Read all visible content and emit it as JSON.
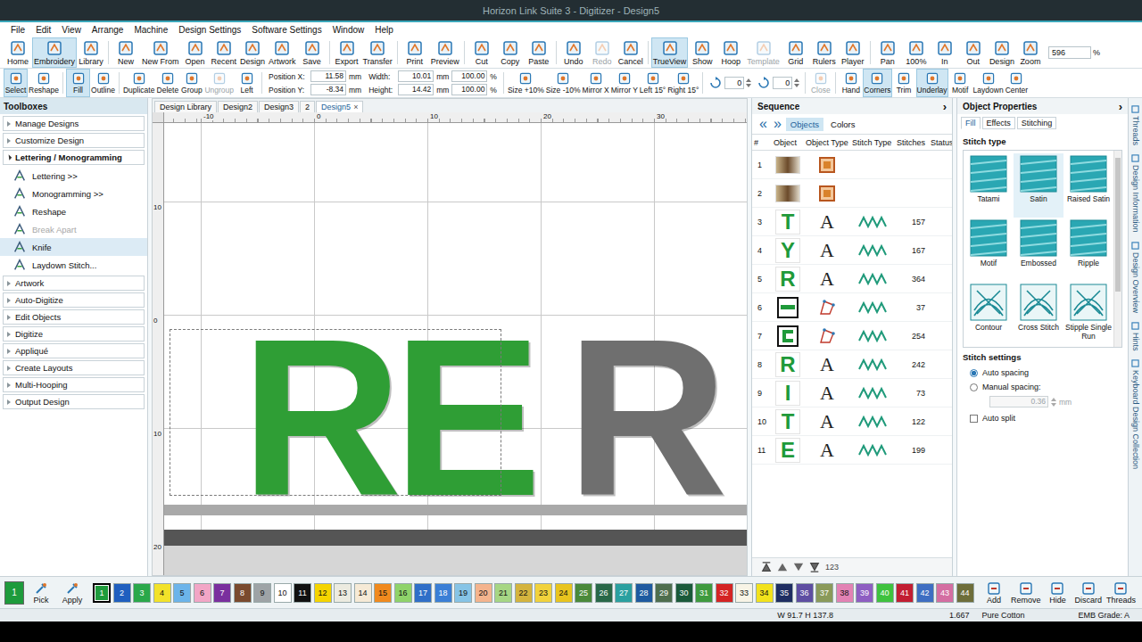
{
  "window": {
    "title": "Horizon Link Suite 3 - Digitizer - Design5"
  },
  "menu": [
    "File",
    "Edit",
    "View",
    "Arrange",
    "Machine",
    "Design Settings",
    "Software Settings",
    "Window",
    "Help"
  ],
  "toolbar": [
    {
      "kind": "button",
      "label": "Home",
      "selected": false,
      "disabled": false
    },
    {
      "kind": "button",
      "label": "Embroidery",
      "selected": true,
      "disabled": false
    },
    {
      "kind": "button",
      "label": "Library",
      "selected": false,
      "disabled": false
    },
    {
      "kind": "separator"
    },
    {
      "kind": "button",
      "label": "New",
      "selected": false,
      "disabled": false
    },
    {
      "kind": "button",
      "label": "New From",
      "selected": false,
      "disabled": false
    },
    {
      "kind": "button",
      "label": "Open",
      "selected": false,
      "disabled": false
    },
    {
      "kind": "button",
      "label": "Recent",
      "selected": false,
      "disabled": false
    },
    {
      "kind": "button",
      "label": "Design",
      "selected": false,
      "disabled": false
    },
    {
      "kind": "button",
      "label": "Artwork",
      "selected": false,
      "disabled": false
    },
    {
      "kind": "button",
      "label": "Save",
      "selected": false,
      "disabled": false
    },
    {
      "kind": "separator"
    },
    {
      "kind": "button",
      "label": "Export",
      "selected": false,
      "disabled": false
    },
    {
      "kind": "button",
      "label": "Transfer",
      "selected": false,
      "disabled": false
    },
    {
      "kind": "separator"
    },
    {
      "kind": "button",
      "label": "Print",
      "selected": false,
      "disabled": false
    },
    {
      "kind": "button",
      "label": "Preview",
      "selected": false,
      "disabled": false
    },
    {
      "kind": "separator"
    },
    {
      "kind": "button",
      "label": "Cut",
      "selected": false,
      "disabled": false
    },
    {
      "kind": "button",
      "label": "Copy",
      "selected": false,
      "disabled": false
    },
    {
      "kind": "button",
      "label": "Paste",
      "selected": false,
      "disabled": false
    },
    {
      "kind": "separator"
    },
    {
      "kind": "button",
      "label": "Undo",
      "selected": false,
      "disabled": false
    },
    {
      "kind": "button",
      "label": "Redo",
      "selected": false,
      "disabled": true
    },
    {
      "kind": "button",
      "label": "Cancel",
      "selected": false,
      "disabled": false
    },
    {
      "kind": "separator"
    },
    {
      "kind": "button",
      "label": "TrueView",
      "selected": true,
      "disabled": false
    },
    {
      "kind": "button",
      "label": "Show",
      "selected": false,
      "disabled": false
    },
    {
      "kind": "button",
      "label": "Hoop",
      "selected": false,
      "disabled": false
    },
    {
      "kind": "button",
      "label": "Template",
      "selected": false,
      "disabled": true
    },
    {
      "kind": "button",
      "label": "Grid",
      "selected": false,
      "disabled": false
    },
    {
      "kind": "button",
      "label": "Rulers",
      "selected": false,
      "disabled": false
    },
    {
      "kind": "button",
      "label": "Player",
      "selected": false,
      "disabled": false
    },
    {
      "kind": "separator"
    },
    {
      "kind": "button",
      "label": "Pan",
      "selected": false,
      "disabled": false
    },
    {
      "kind": "button",
      "label": "100%",
      "selected": false,
      "disabled": false
    },
    {
      "kind": "button",
      "label": "In",
      "selected": false,
      "disabled": false
    },
    {
      "kind": "button",
      "label": "Out",
      "selected": false,
      "disabled": false
    },
    {
      "kind": "button",
      "label": "Design",
      "selected": false,
      "disabled": false
    },
    {
      "kind": "button",
      "label": "Zoom",
      "selected": false,
      "disabled": false
    },
    {
      "kind": "field",
      "value": "596",
      "unit": "%"
    }
  ],
  "toolbar2": [
    {
      "kind": "button",
      "label": "Select",
      "selected": true,
      "disabled": false
    },
    {
      "kind": "button",
      "label": "Reshape",
      "selected": false,
      "disabled": false
    },
    {
      "kind": "separator"
    },
    {
      "kind": "button",
      "label": "Fill",
      "selected": true,
      "disabled": false
    },
    {
      "kind": "button",
      "label": "Outline",
      "selected": false,
      "disabled": false
    },
    {
      "kind": "separator"
    },
    {
      "kind": "button",
      "label": "Duplicate",
      "selected": false,
      "disabled": false
    },
    {
      "kind": "button",
      "label": "Delete",
      "selected": false,
      "disabled": false
    },
    {
      "kind": "button",
      "label": "Group",
      "selected": false,
      "disabled": false
    },
    {
      "kind": "button",
      "label": "Ungroup",
      "selected": false,
      "disabled": true
    },
    {
      "kind": "button",
      "label": "Left",
      "selected": false,
      "disabled": false
    },
    {
      "kind": "separator"
    },
    {
      "kind": "fields",
      "rows": [
        {
          "label": "Position X:",
          "value": "11.58",
          "unit": "mm"
        },
        {
          "label": "Position Y:",
          "value": "-8.34",
          "unit": "mm"
        }
      ]
    },
    {
      "kind": "fields",
      "rows": [
        {
          "label": "Width:",
          "value": "10.01",
          "unit": "mm",
          "pct": "100.00",
          "pct_unit": "%"
        },
        {
          "label": "Height:",
          "value": "14.42",
          "unit": "mm",
          "pct": "100.00",
          "pct_unit": "%"
        }
      ]
    },
    {
      "kind": "separator"
    },
    {
      "kind": "button",
      "label": "Size +10%",
      "selected": false,
      "disabled": false
    },
    {
      "kind": "button",
      "label": "Size -10%",
      "selected": false,
      "disabled": false
    },
    {
      "kind": "button",
      "label": "Mirror X",
      "selected": false,
      "disabled": false
    },
    {
      "kind": "button",
      "label": "Mirror Y",
      "selected": false,
      "disabled": false
    },
    {
      "kind": "button",
      "label": "Left 15°",
      "selected": false,
      "disabled": false
    },
    {
      "kind": "button",
      "label": "Right 15°",
      "selected": false,
      "disabled": false
    },
    {
      "kind": "separator"
    },
    {
      "kind": "spin",
      "value": "0"
    },
    {
      "kind": "spin",
      "value": "0"
    },
    {
      "kind": "separator"
    },
    {
      "kind": "button",
      "label": "Close",
      "selected": false,
      "disabled": true
    },
    {
      "kind": "separator"
    },
    {
      "kind": "button",
      "label": "Hand",
      "selected": false,
      "disabled": false
    },
    {
      "kind": "button",
      "label": "Corners",
      "selected": true,
      "disabled": false
    },
    {
      "kind": "button",
      "label": "Trim",
      "selected": false,
      "disabled": false
    },
    {
      "kind": "button",
      "label": "Underlay",
      "selected": true,
      "disabled": false
    },
    {
      "kind": "button",
      "label": "Motif",
      "selected": false,
      "disabled": false
    },
    {
      "kind": "button",
      "label": "Laydown",
      "selected": false,
      "disabled": false
    },
    {
      "kind": "button",
      "label": "Center",
      "selected": false,
      "disabled": false
    }
  ],
  "toolboxes": {
    "title": "Toolboxes",
    "sections": [
      {
        "label": "Manage Designs",
        "expanded": false,
        "items": []
      },
      {
        "label": "Customize Design",
        "expanded": false,
        "items": []
      },
      {
        "label": "Lettering / Monogramming",
        "expanded": true,
        "items": [
          {
            "label": "Lettering >>",
            "disabled": false,
            "hovered": false
          },
          {
            "label": "Monogramming >>",
            "disabled": false,
            "hovered": false
          },
          {
            "label": "Reshape",
            "disabled": false,
            "hovered": false
          },
          {
            "label": "Break Apart",
            "disabled": true,
            "hovered": false
          },
          {
            "label": "Knife",
            "disabled": false,
            "hovered": true
          },
          {
            "label": "Laydown Stitch...",
            "disabled": false,
            "hovered": false
          }
        ]
      },
      {
        "label": "Artwork",
        "expanded": false,
        "items": []
      },
      {
        "label": "Auto-Digitize",
        "expanded": false,
        "items": []
      },
      {
        "label": "Edit Objects",
        "expanded": false,
        "items": []
      },
      {
        "label": "Digitize",
        "expanded": false,
        "items": []
      },
      {
        "label": "Appliqué",
        "expanded": false,
        "items": []
      },
      {
        "label": "Create Layouts",
        "expanded": false,
        "items": []
      },
      {
        "label": "Multi-Hooping",
        "expanded": false,
        "items": []
      },
      {
        "label": "Output Design",
        "expanded": false,
        "items": []
      }
    ]
  },
  "doc_tabs": [
    {
      "label": "Design Library",
      "selected": false
    },
    {
      "label": "Design2",
      "selected": false
    },
    {
      "label": "Design3",
      "selected": false
    },
    {
      "label": "2",
      "selected": false
    },
    {
      "label": "Design5",
      "selected": true,
      "close": "×"
    }
  ],
  "canvas": {
    "ruler_top": [
      "-10",
      "0",
      "10",
      "20",
      "30"
    ],
    "ruler_left": [
      "10",
      "0",
      "10",
      "20"
    ],
    "letters": [
      {
        "text": "RE",
        "color": "#2f9e35"
      },
      {
        "text": "R",
        "color": "#6f6f6f"
      }
    ]
  },
  "sequence": {
    "title": "Sequence",
    "collapse": "›",
    "nav": [
      "«",
      "»"
    ],
    "tabs": [
      {
        "label": "Objects",
        "selected": true
      },
      {
        "label": "Colors",
        "selected": false
      }
    ],
    "columns": [
      "#",
      "Object",
      "Object Type",
      "Stitch Type",
      "Stitches",
      "Status"
    ],
    "rows": [
      {
        "num": "1",
        "kind": "artwork"
      },
      {
        "num": "2",
        "kind": "artwork"
      },
      {
        "num": "3",
        "kind": "lettering",
        "thumb": "T",
        "type_glyph": "A",
        "stitches": "157"
      },
      {
        "num": "4",
        "kind": "lettering",
        "thumb": "Y",
        "type_glyph": "A",
        "stitches": "167"
      },
      {
        "num": "5",
        "kind": "lettering",
        "thumb": "R",
        "type_glyph": "A",
        "stitches": "364"
      },
      {
        "num": "6",
        "kind": "shape",
        "stitches": "37"
      },
      {
        "num": "7",
        "kind": "shape",
        "stitches": "254"
      },
      {
        "num": "8",
        "kind": "lettering",
        "thumb": "R",
        "type_glyph": "A",
        "stitches": "242"
      },
      {
        "num": "9",
        "kind": "lettering",
        "thumb": "I",
        "type_glyph": "A",
        "stitches": "73"
      },
      {
        "num": "10",
        "kind": "lettering",
        "thumb": "T",
        "type_glyph": "A",
        "stitches": "122"
      },
      {
        "num": "11",
        "kind": "lettering",
        "thumb": "E",
        "type_glyph": "A",
        "stitches": "199"
      }
    ],
    "order_label": "123"
  },
  "properties": {
    "title": "Object Properties",
    "collapse": "›",
    "tabs": [
      {
        "label": "Fill",
        "selected": true
      },
      {
        "label": "Effects",
        "selected": false
      },
      {
        "label": "Stitching",
        "selected": false
      }
    ],
    "stitch_type_title": "Stitch type",
    "tiles": [
      {
        "label": "Tatami",
        "selected": false
      },
      {
        "label": "Satin",
        "selected": true
      },
      {
        "label": "Raised Satin",
        "selected": false
      },
      {
        "label": "Motif",
        "selected": false
      },
      {
        "label": "Embossed",
        "selected": false
      },
      {
        "label": "Ripple",
        "selected": false
      },
      {
        "label": "Contour",
        "selected": false
      },
      {
        "label": "Cross Stitch",
        "selected": false
      },
      {
        "label": "Stipple Single Run",
        "selected": false
      }
    ],
    "settings_title": "Stitch settings",
    "spacing": [
      {
        "label": "Auto spacing",
        "selected": true
      },
      {
        "label": "Manual spacing:",
        "selected": false
      }
    ],
    "spacing_value": {
      "value": "0.36",
      "unit": "mm",
      "disabled": true
    },
    "auto_split": {
      "label": "Auto split",
      "checked": false
    }
  },
  "side_tabs": [
    "Threads",
    "Design Information",
    "Design Overview",
    "Hints",
    "Keyboard Design Collection"
  ],
  "colorbar": {
    "current": {
      "label": "1",
      "color": "#1e9b3c"
    },
    "tools": [
      "Pick",
      "Apply"
    ],
    "swatches": [
      {
        "label": "1",
        "color": "#1e9b3c",
        "selected": true
      },
      {
        "label": "2",
        "color": "#1f5fbf",
        "selected": false
      },
      {
        "label": "3",
        "color": "#2aa84a",
        "selected": false
      },
      {
        "label": "4",
        "color": "#f2e22a",
        "selected": false
      },
      {
        "label": "5",
        "color": "#6cb4ea",
        "selected": false
      },
      {
        "label": "6",
        "color": "#f2a6c6",
        "selected": false
      },
      {
        "label": "7",
        "color": "#7a2f9e",
        "selected": false
      },
      {
        "label": "8",
        "color": "#7a4a2e",
        "selected": false
      },
      {
        "label": "9",
        "color": "#9ea3a6",
        "selected": false
      },
      {
        "label": "10",
        "color": "#ffffff",
        "selected": false
      },
      {
        "label": "11",
        "color": "#111111",
        "selected": false
      },
      {
        "label": "12",
        "color": "#f5d400",
        "selected": false
      },
      {
        "label": "13",
        "color": "#ecebe0",
        "selected": false
      },
      {
        "label": "14",
        "color": "#f6ead6",
        "selected": false
      },
      {
        "label": "15",
        "color": "#f08a1e",
        "selected": false
      },
      {
        "label": "16",
        "color": "#8fd36a",
        "selected": false
      },
      {
        "label": "17",
        "color": "#2f6fc8",
        "selected": false
      },
      {
        "label": "18",
        "color": "#3a7fd6",
        "selected": false
      },
      {
        "label": "19",
        "color": "#86c4e6",
        "selected": false
      },
      {
        "label": "20",
        "color": "#f4b48e",
        "selected": false
      },
      {
        "label": "21",
        "color": "#a6d684",
        "selected": false
      },
      {
        "label": "22",
        "color": "#d4b43e",
        "selected": false
      },
      {
        "label": "23",
        "color": "#f1d23c",
        "selected": false
      },
      {
        "label": "24",
        "color": "#e8c41e",
        "selected": false
      },
      {
        "label": "25",
        "color": "#4a8a3a",
        "selected": false
      },
      {
        "label": "26",
        "color": "#286848",
        "selected": false
      },
      {
        "label": "27",
        "color": "#2aa0a0",
        "selected": false
      },
      {
        "label": "28",
        "color": "#1e5aa0",
        "selected": false
      },
      {
        "label": "29",
        "color": "#4e6e4e",
        "selected": false
      },
      {
        "label": "30",
        "color": "#1a5a3a",
        "selected": false
      },
      {
        "label": "31",
        "color": "#3e9a3e",
        "selected": false
      },
      {
        "label": "32",
        "color": "#d42424",
        "selected": false
      },
      {
        "label": "33",
        "color": "#f8f4e6",
        "selected": false
      },
      {
        "label": "34",
        "color": "#f2e21c",
        "selected": false
      },
      {
        "label": "35",
        "color": "#1e2e62",
        "selected": false
      },
      {
        "label": "36",
        "color": "#5e4ea2",
        "selected": false
      },
      {
        "label": "37",
        "color": "#8a9a5a",
        "selected": false
      },
      {
        "label": "38",
        "color": "#e282b4",
        "selected": false
      },
      {
        "label": "39",
        "color": "#8e5ec2",
        "selected": false
      },
      {
        "label": "40",
        "color": "#3ec23e",
        "selected": false
      },
      {
        "label": "41",
        "color": "#c21e32",
        "selected": false
      },
      {
        "label": "42",
        "color": "#3e6ec2",
        "selected": false
      },
      {
        "label": "43",
        "color": "#d46ea2",
        "selected": false
      },
      {
        "label": "44",
        "color": "#6e6e3a",
        "selected": false
      }
    ],
    "actions": [
      "Add",
      "Remove",
      "Hide",
      "Discard",
      "Threads"
    ]
  },
  "status_bar": [
    "W 91.7 H 137.8",
    "1.667",
    "Pure Cotton",
    "EMB Grade: A"
  ]
}
